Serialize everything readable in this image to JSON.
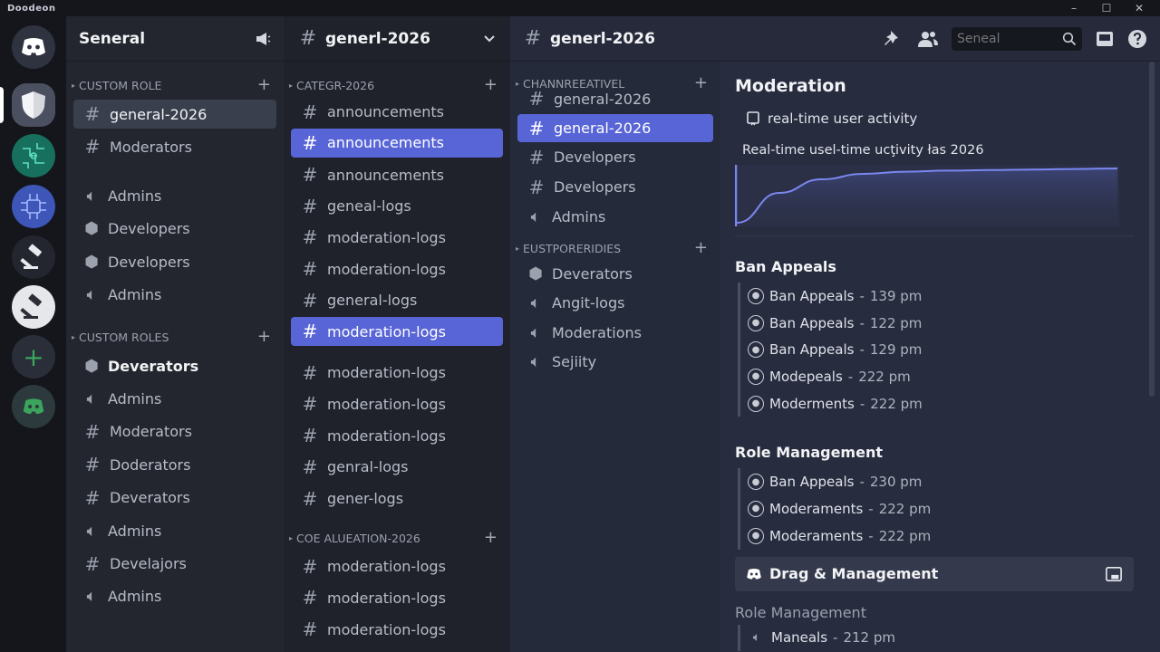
{
  "window": {
    "app_title": "Doodeon",
    "minimize": "–",
    "maximize": "☐",
    "close": "✕"
  },
  "col1": {
    "header_title": "Seneral",
    "section1": "Custom Role",
    "items1": [
      {
        "label": "general-2026",
        "type": "text"
      },
      {
        "label": "Moderators",
        "type": "text"
      }
    ],
    "items1b": [
      {
        "label": "Admins",
        "type": "voice"
      },
      {
        "label": "Developers",
        "type": "stage"
      },
      {
        "label": "Developers",
        "type": "stage"
      },
      {
        "label": "Admins",
        "type": "voice"
      }
    ],
    "section2": "Custom Roles",
    "items2": [
      {
        "label": "Deverators",
        "type": "stage"
      },
      {
        "label": "Admins",
        "type": "voice"
      },
      {
        "label": "Moderators",
        "type": "text"
      },
      {
        "label": "Doderators",
        "type": "text"
      },
      {
        "label": "Deverators",
        "type": "text"
      },
      {
        "label": "Admins",
        "type": "voice"
      },
      {
        "label": "Develajors",
        "type": "text"
      },
      {
        "label": "Admins",
        "type": "voice"
      }
    ]
  },
  "col2": {
    "header_title": "generl-2026",
    "section1": "Categr-2026",
    "items1": [
      "announcements",
      "announcements",
      "announcements",
      "geneal-logs",
      "moderation-logs",
      "moderation-logs",
      "general-logs",
      "moderation-logs"
    ],
    "items2": [
      "moderation-logs",
      "moderation-logs",
      "moderation-logs",
      "genral-logs",
      "gener-logs"
    ],
    "section2": "Coe Alueation-2026",
    "items3": [
      "moderation-logs",
      "moderation-logs",
      "moderation-logs"
    ]
  },
  "topbar": {
    "title": "generl-2026",
    "search_placeholder": "Seneal"
  },
  "col3": {
    "section1": "Channreeativel",
    "items1": [
      {
        "label": "general-2026",
        "type": "text"
      },
      {
        "label": "general-2026",
        "type": "text"
      },
      {
        "label": "Developers",
        "type": "text"
      },
      {
        "label": "Developers",
        "type": "text"
      },
      {
        "label": "Admins",
        "type": "voice"
      }
    ],
    "section2": "Eustporeridies",
    "items2": [
      {
        "label": "Deverators",
        "type": "stage"
      },
      {
        "label": "Angit-logs",
        "type": "voice"
      },
      {
        "label": "Moderations",
        "type": "voice"
      },
      {
        "label": "Sejiity",
        "type": "voice"
      }
    ]
  },
  "moderation": {
    "title": "Moderation",
    "activity_label": "real-time user activity",
    "chart_caption": "Real-time usel-time ucţivity łas 2026",
    "ban_title": "Ban Appeals",
    "ban_entries": [
      {
        "name": "Ban Appeals",
        "time": "139 pm"
      },
      {
        "name": "Ban Appeals",
        "time": "122 pm"
      },
      {
        "name": "Ban Appeals",
        "time": "129 pm"
      },
      {
        "name": "Modepeals",
        "time": "222 pm"
      },
      {
        "name": "Moderments",
        "time": "222 pm"
      }
    ],
    "role_title": "Role Management",
    "role_entries": [
      {
        "name": "Ban Appeals",
        "time": "230 pm"
      },
      {
        "name": "Moderaments",
        "time": "222 pm"
      },
      {
        "name": "Moderaments",
        "time": "222 pm"
      }
    ],
    "drag_label": "Drag & Management",
    "role_title2": "Role Management",
    "role_entries2": [
      {
        "name": "Maneals",
        "time": "212 pm"
      }
    ],
    "separator": " - "
  },
  "colors": {
    "accent": "#5865d6",
    "selected_grey": "#3a3f4d",
    "chart_line": "#7b87f0"
  },
  "chart_data": {
    "type": "line",
    "series": [
      {
        "values": [
          0,
          0.55,
          0.8,
          0.9,
          0.94,
          0.96,
          0.97,
          0.98,
          0.99,
          1.0
        ]
      }
    ]
  }
}
